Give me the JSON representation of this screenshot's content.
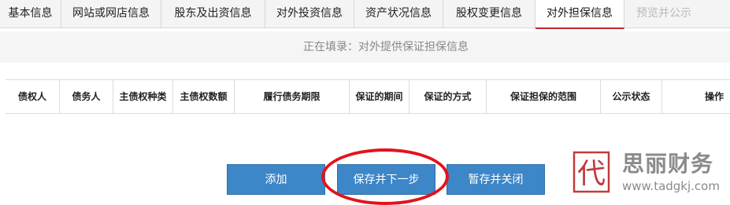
{
  "tabs": [
    {
      "label": "基本信息"
    },
    {
      "label": "网站或网店信息"
    },
    {
      "label": "股东及出资信息"
    },
    {
      "label": "对外投资信息"
    },
    {
      "label": "资产状况信息"
    },
    {
      "label": "股权变更信息"
    },
    {
      "label": "对外担保信息"
    },
    {
      "label": "预览并公示"
    }
  ],
  "active_tab": "对外担保信息",
  "subtitle": "正在填录：对外提供保证担保信息",
  "table": {
    "columns": [
      "债权人",
      "债务人",
      "主债权种类",
      "主债权数额",
      "履行债务期限",
      "保证的期间",
      "保证的方式",
      "保证担保的范围",
      "公示状态",
      "操作"
    ],
    "rows": []
  },
  "buttons": {
    "add": "添加",
    "save_next": "保存并下一步",
    "save_close": "暂存并关闭"
  },
  "watermark": {
    "seal_char": "代",
    "brand": "思丽财务",
    "url": "www.tadgkj.com"
  },
  "colors": {
    "button_blue": "#3d86c8",
    "active_tab_underline": "#c1272d",
    "annotation_red": "#e3121b"
  }
}
